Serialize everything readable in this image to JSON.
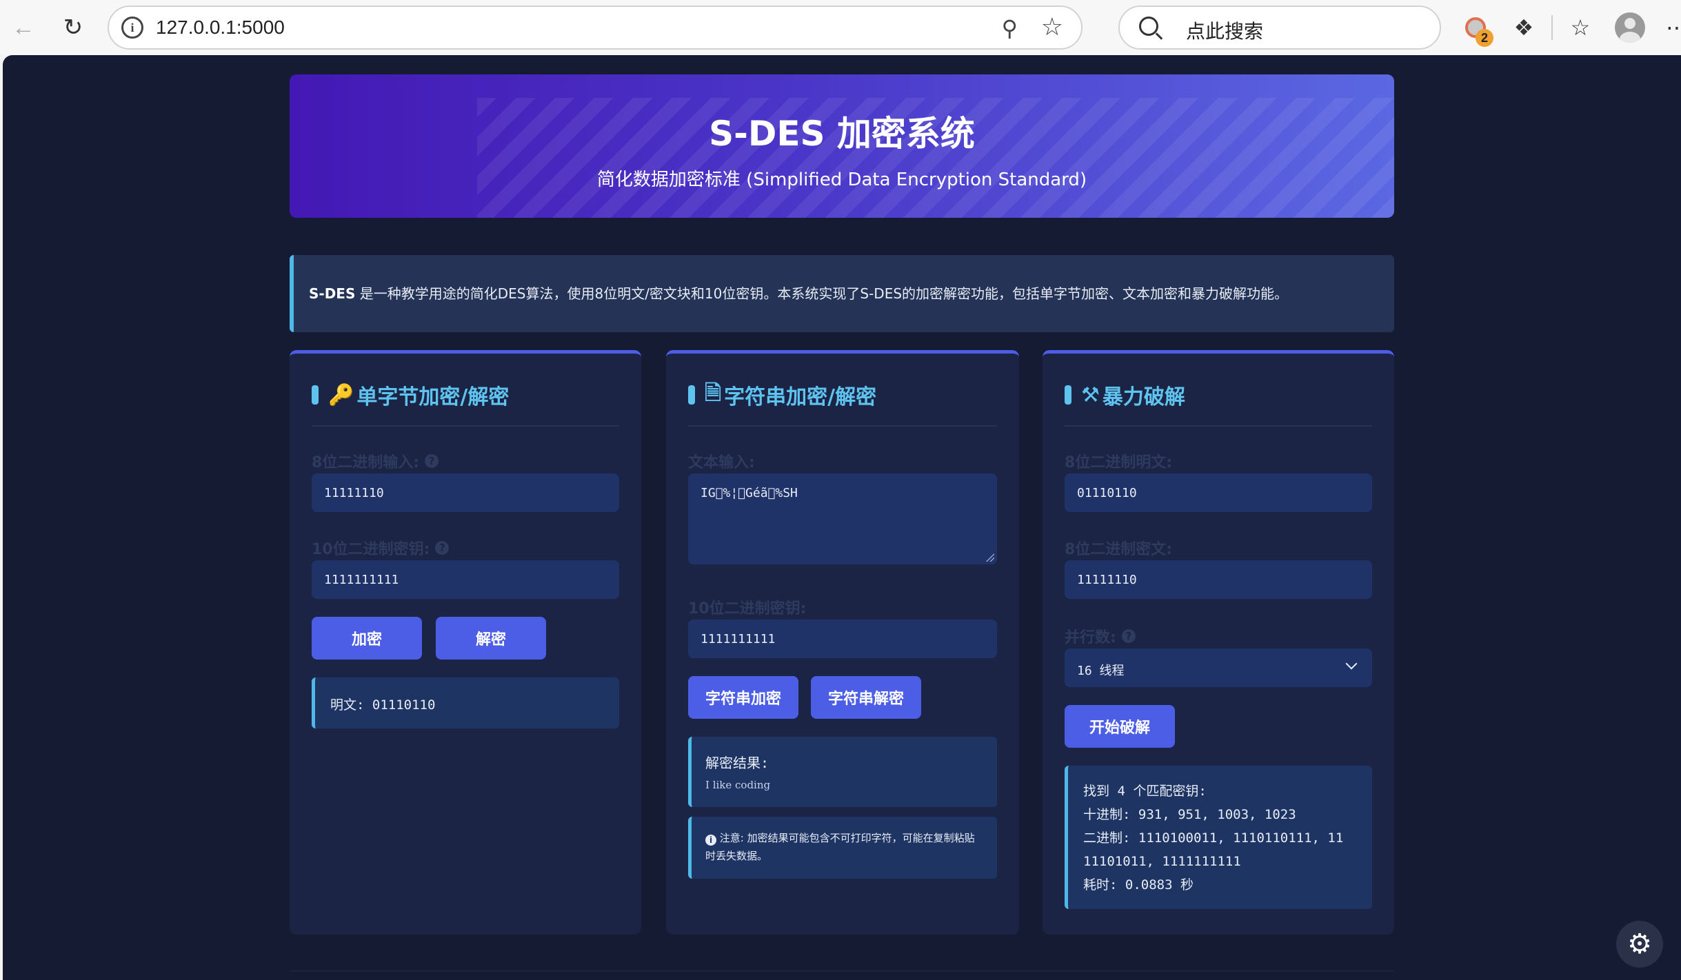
{
  "browser": {
    "url": "127.0.0.1:5000",
    "search_placeholder": "点此搜索",
    "profile_badge": "2"
  },
  "header": {
    "title": "S-DES 加密系统",
    "subtitle": "简化数据加密标准 (Simplified Data Encryption Standard)"
  },
  "intro": {
    "lead": "S-DES",
    "text": " 是一种教学用途的简化DES算法，使用8位明文/密文块和10位密钥。本系统实现了S-DES的加密解密功能，包括单字节加密、文本加密和暴力破解功能。"
  },
  "single": {
    "title": "单字节加密/解密",
    "input_label": "8位二进制输入:",
    "input_value": "11111110",
    "key_label": "10位二进制密钥:",
    "key_value": "1111111111",
    "encrypt_btn": "加密",
    "decrypt_btn": "解密",
    "result": "明文: 01110110"
  },
  "string": {
    "title": "字符串加密/解密",
    "text_label": "文本输入:",
    "text_value": "IG\u0000%¦\u0000Géã\u0000%SH",
    "key_label": "10位二进制密钥:",
    "key_value": "1111111111",
    "encrypt_btn": "字符串加密",
    "decrypt_btn": "字符串解密",
    "result_title": "解密结果:",
    "result_value": "I like coding",
    "note": "注意: 加密结果可能包含不可打印字符，可能在复制粘贴时丢失数据。"
  },
  "brute": {
    "title": "暴力破解",
    "plain_label": "8位二进制明文:",
    "plain_value": "01110110",
    "cipher_label": "8位二进制密文:",
    "cipher_value": "11111110",
    "threads_label": "并行数:",
    "threads_value": "16 线程",
    "start_btn": "开始破解",
    "result_found": "找到 4 个匹配密钥:",
    "result_decimal": "十进制: 931, 951, 1003, 1023",
    "result_binary_1": "二进制: 1110100011, 1110110111, 11",
    "result_binary_2": "11101011, 1111111111",
    "result_time": "耗时: 0.0883 秒"
  }
}
